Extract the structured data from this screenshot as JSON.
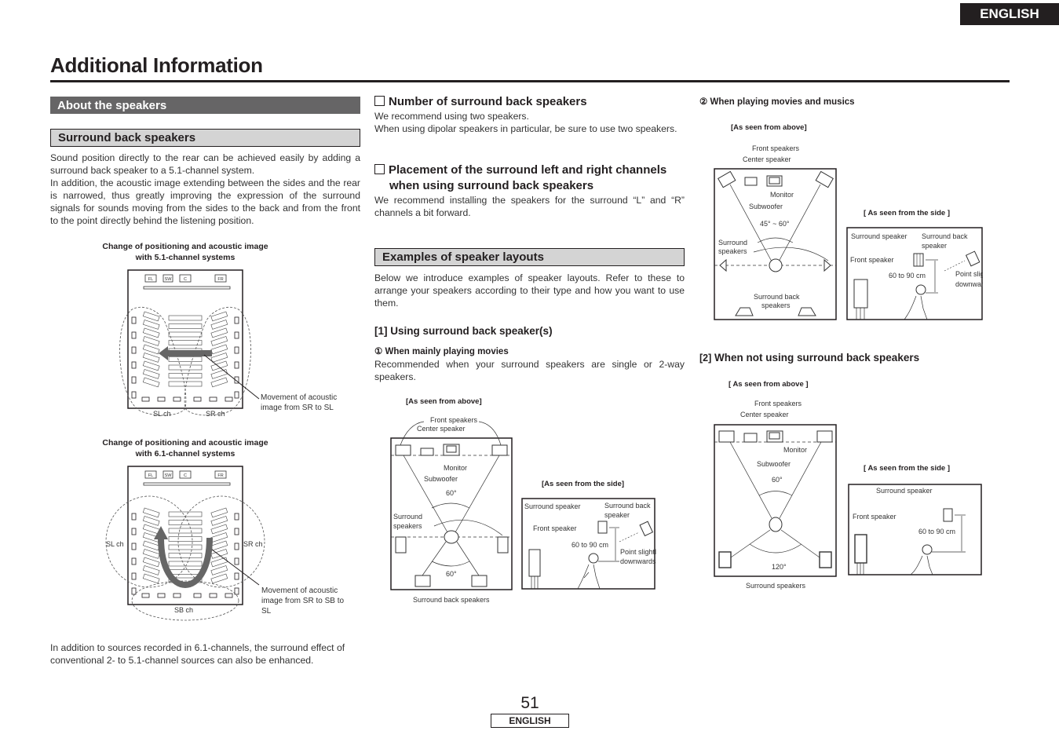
{
  "header": {
    "language_tab": "ENGLISH",
    "page_title": "Additional Information"
  },
  "left": {
    "section_title": "About the speakers",
    "subsection_title": "Surround back speakers",
    "intro_lines": [
      "Sound position directly to the rear can be achieved easily by adding a surround back speaker to a 5.1-channel system.",
      "In addition, the acoustic image extending between the sides and the rear is narrowed, thus greatly improving the expression of the surround signals for sounds moving from the sides to the back and from the front to the point directly behind the listening position."
    ],
    "fig1": {
      "caption_line1": "Change of positioning and acoustic image",
      "caption_line2": "with 5.1-channel systems",
      "speakers": [
        "FL",
        "SW",
        "C",
        "FR"
      ],
      "label_left": "SL ch",
      "label_right": "SR ch",
      "note_line1": "Movement of acoustic",
      "note_line2": "image from SR to SL"
    },
    "fig2": {
      "caption_line1": "Change of positioning and acoustic image",
      "caption_line2": "with 6.1-channel systems",
      "speakers": [
        "FL",
        "SW",
        "C",
        "FR"
      ],
      "label_left": "SL ch",
      "label_right": "SR ch",
      "label_back": "SB ch",
      "note_line1": "Movement of acoustic",
      "note_line2": "image from SR to SB to",
      "note_line3": "SL"
    },
    "closing_text": "In addition to sources recorded in 6.1-channels, the surround effect of conventional 2- to 5.1-channel sources can also be enhanced."
  },
  "middle": {
    "number_head": "Number of surround back speakers",
    "number_text1": "We recommend using two speakers.",
    "number_text2": "When using dipolar speakers in particular, be sure to use two speakers.",
    "placement_head1": "Placement of the surround left and right channels",
    "placement_head2": "when using surround back speakers",
    "placement_text": "We recommend installing the speakers for the surround “L” and “R” channels a bit forward.",
    "examples_title": "Examples of speaker layouts",
    "examples_text": "Below we introduce examples of speaker layouts. Refer to these to arrange your speakers according to their type and how you want to use them.",
    "using_head": "[1] Using surround back speaker(s)",
    "movies_head": "① When mainly playing movies",
    "movies_text": "Recommended when your surround speakers are single or 2-way speakers.",
    "above": {
      "caption": "[As seen from above]",
      "front_speakers": "Front speakers",
      "center_speaker": "Center speaker",
      "monitor": "Monitor",
      "subwoofer": "Subwoofer",
      "angle_front": "60°",
      "surround1": "Surround",
      "surround2": "speakers",
      "angle_back": "60°",
      "surround_back": "Surround back speakers"
    },
    "side": {
      "caption": "[As seen from the side]",
      "surround_speaker": "Surround speaker",
      "surround_back1": "Surround back",
      "surround_back2": "speaker",
      "front_speaker": "Front speaker",
      "height": "60 to 90 cm",
      "point1": "Point slightly",
      "point2": "downwards"
    }
  },
  "right": {
    "movies_music_head": "② When playing movies and musics",
    "above": {
      "caption": "[As seen from above]",
      "front_speakers": "Front speakers",
      "center_speaker": "Center speaker",
      "monitor": "Monitor",
      "subwoofer": "Subwoofer",
      "angle": "45° ~ 60°",
      "surround1": "Surround",
      "surround2": "speakers",
      "surround_back1": "Surround back",
      "surround_back2": "speakers"
    },
    "side": {
      "caption": "[ As seen from the side ]",
      "surround_speaker": "Surround speaker",
      "surround_back1": "Surround back",
      "surround_back2": "speaker",
      "front_speaker": "Front speaker",
      "height": "60 to 90 cm",
      "point1": "Point slightly",
      "point2": "downwards"
    },
    "not_using_num": "[2]",
    "not_using_head": "When not using surround back speakers",
    "above2": {
      "caption": "[ As seen from above ]",
      "front_speakers": "Front speakers",
      "center_speaker": "Center speaker",
      "monitor": "Monitor",
      "subwoofer": "Subwoofer",
      "angle_front": "60°",
      "angle_back": "120°",
      "surround": "Surround speakers"
    },
    "side2": {
      "caption": "[ As seen from the side ]",
      "surround_speaker": "Surround speaker",
      "front_speaker": "Front speaker",
      "height": "60 to 90 cm"
    }
  },
  "footer": {
    "page_number": "51",
    "language": "ENGLISH"
  }
}
